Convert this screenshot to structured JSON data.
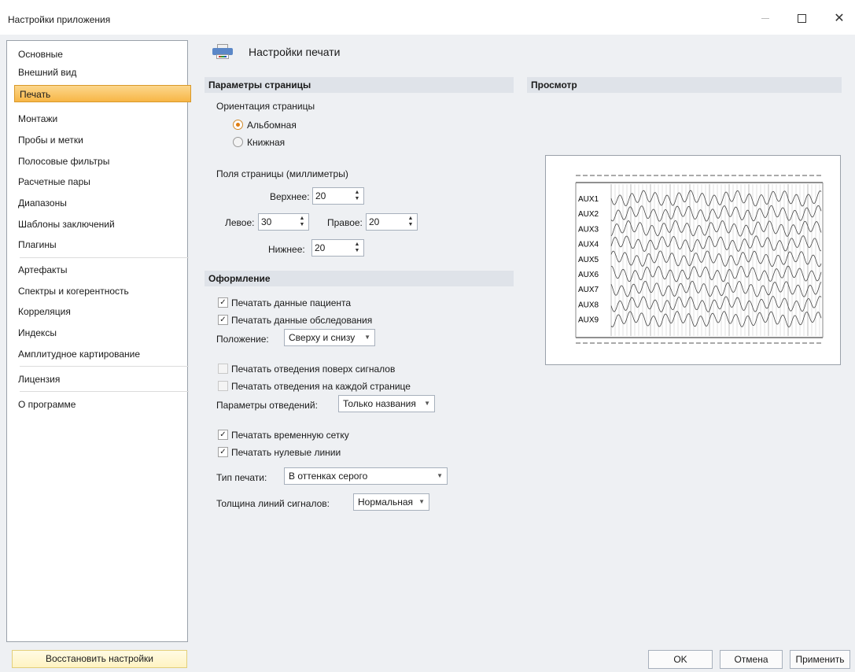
{
  "window": {
    "title": "Настройки приложения"
  },
  "nav": {
    "items": [
      {
        "label": "Основные"
      },
      {
        "label": "Внешний вид"
      },
      {
        "label": "Печать"
      },
      {
        "label": "Монтажи"
      },
      {
        "label": "Пробы и метки"
      },
      {
        "label": "Полосовые фильтры"
      },
      {
        "label": "Расчетные пары"
      },
      {
        "label": "Диапазоны"
      },
      {
        "label": "Шаблоны заключений"
      },
      {
        "label": "Плагины"
      },
      {
        "label": "Артефакты"
      },
      {
        "label": "Спектры и когерентность"
      },
      {
        "label": "Корреляция"
      },
      {
        "label": "Индексы"
      },
      {
        "label": "Амплитудное картирование"
      },
      {
        "label": "Лицензия"
      },
      {
        "label": "О программе"
      }
    ],
    "active": "Печать",
    "restore_label": "Восстановить настройки"
  },
  "content": {
    "icon": "printer-icon",
    "title": "Настройки печати"
  },
  "page_params": {
    "header": "Параметры страницы",
    "orientation_label": "Ориентация страницы",
    "landscape": "Альбомная",
    "portrait": "Книжная",
    "selected": "Альбомная",
    "margins_label": "Поля страницы (миллиметры)",
    "top_label": "Верхнее:",
    "top": "20",
    "left_label": "Левое:",
    "left": "30",
    "right_label": "Правое:",
    "right": "20",
    "bottom_label": "Нижнее:",
    "bottom": "20"
  },
  "design": {
    "header": "Оформление",
    "print_patient": {
      "label": "Печатать данные пациента",
      "checked": true
    },
    "print_exam": {
      "label": "Печатать данные обследования",
      "checked": true
    },
    "position_label": "Положение:",
    "position_value": "Сверху и снизу",
    "print_leads_over": {
      "label": "Печатать отведения поверх сигналов",
      "checked": false
    },
    "print_leads_each": {
      "label": "Печатать отведения на каждой странице",
      "checked": false
    },
    "lead_params_label": "Параметры отведений:",
    "lead_params_value": "Только названия",
    "print_grid": {
      "label": "Печатать временную сетку",
      "checked": true
    },
    "print_zero": {
      "label": "Печатать нулевые линии",
      "checked": true
    },
    "print_type_label": "Тип печати:",
    "print_type_value": "В оттенках серого",
    "line_width_label": "Толщина линий сигналов:",
    "line_width_value": "Нормальная"
  },
  "preview": {
    "header": "Просмотр",
    "channels": [
      "AUX1",
      "AUX2",
      "AUX3",
      "AUX4",
      "AUX5",
      "AUX6",
      "AUX7",
      "AUX8",
      "AUX9"
    ]
  },
  "buttons": {
    "ok": "OK",
    "cancel": "Отмена",
    "apply": "Применить"
  },
  "glyphs": {
    "close": "✕",
    "check": "✓",
    "up": "▲",
    "down": "▼",
    "dropdown": "▼"
  }
}
